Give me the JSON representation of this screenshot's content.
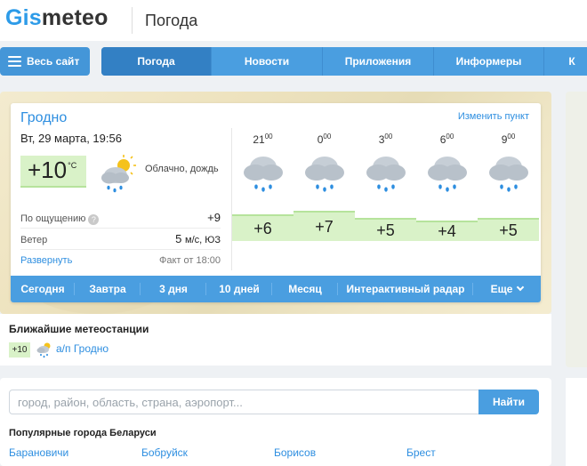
{
  "header": {
    "logo_accent": "Gis",
    "logo_rest": "meteo",
    "title": "Погода"
  },
  "nav": {
    "all_site": "Весь сайт",
    "items": [
      {
        "label": "Погода",
        "active": true
      },
      {
        "label": "Новости"
      },
      {
        "label": "Приложения"
      },
      {
        "label": "Информеры"
      },
      {
        "label": "К"
      }
    ]
  },
  "weather": {
    "city": "Гродно",
    "change_point": "Изменить пункт",
    "datetime": "Вт, 29 марта, 19:56",
    "now_temp": "+10",
    "unit": "°C",
    "description": "Облачно, дождь",
    "feels_label": "По ощущению",
    "feels_value": "+9",
    "wind_label": "Ветер",
    "wind_value": "5",
    "wind_unit": "м/с, ЮЗ",
    "expand": "Развернуть",
    "fact": "Факт от 18:00",
    "hours": [
      {
        "hour": "21",
        "min": "00",
        "temp": "+6",
        "icon": "cloud-rain-icon"
      },
      {
        "hour": "0",
        "min": "00",
        "temp": "+7",
        "icon": "cloud-rain-icon"
      },
      {
        "hour": "3",
        "min": "00",
        "temp": "+5",
        "icon": "cloud-rain-icon"
      },
      {
        "hour": "6",
        "min": "00",
        "temp": "+4",
        "icon": "cloud-rain-icon"
      },
      {
        "hour": "9",
        "min": "00",
        "temp": "+5",
        "icon": "cloud-rain-icon"
      }
    ],
    "tabs": [
      "Сегодня",
      "Завтра",
      "3 дня",
      "10 дней",
      "Месяц",
      "Интерактивный радар",
      "Еще"
    ]
  },
  "stations": {
    "title": "Ближайшие метеостанции",
    "items": [
      {
        "temp": "+10",
        "name": "а/п Гродно",
        "icon": "cloud-rain-sun-icon"
      }
    ]
  },
  "search": {
    "placeholder": "город, район, область, страна, аэропорт...",
    "button": "Найти"
  },
  "popular": {
    "title": "Популярные города Беларуси",
    "cities": [
      "Барановичи",
      "Бобруйск",
      "Борисов",
      "Брест"
    ]
  },
  "colors": {
    "accent": "#4a9ee0",
    "link": "#2d8ee0",
    "temp_bg": "#d9f2c8"
  }
}
